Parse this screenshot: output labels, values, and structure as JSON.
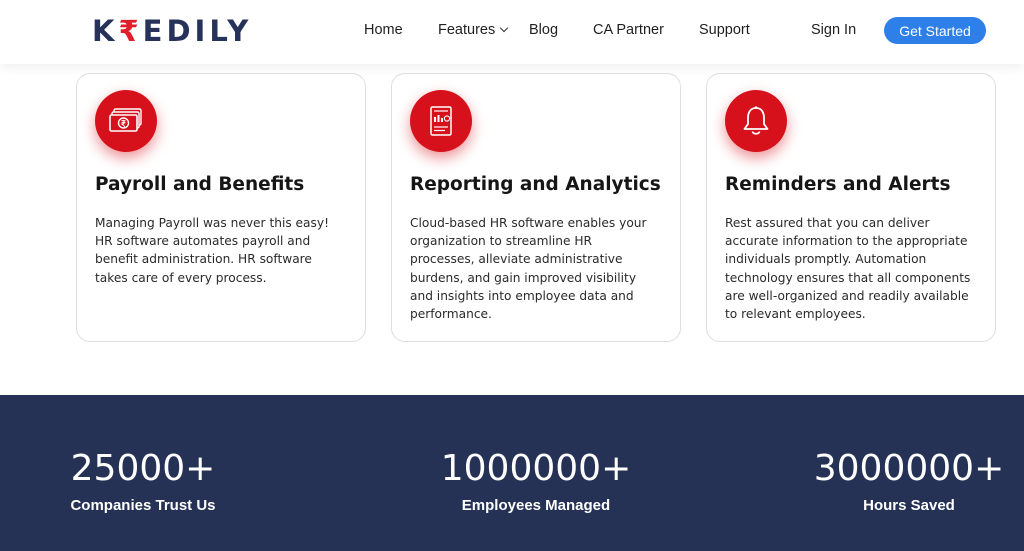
{
  "header": {
    "logo": {
      "prefix": "K",
      "mark": "₹",
      "suffix": "EDILY"
    },
    "nav": [
      "Home",
      "Features",
      "Blog",
      "CA Partner",
      "Support"
    ],
    "sign_in": "Sign In",
    "cta": "Get Started"
  },
  "cards": [
    {
      "icon": "money-icon",
      "title": "Payroll and Benefits",
      "description": "Managing Payroll was never this easy! HR software automates payroll and benefit administration. HR software takes care of every process."
    },
    {
      "icon": "report-chart-icon",
      "title": "Reporting and Analytics",
      "description": "Cloud-based HR software enables your organization to streamline HR processes, alleviate administrative burdens, and gain improved visibility and insights into employee data and performance."
    },
    {
      "icon": "bell-icon",
      "title": "Reminders and Alerts",
      "description": "Rest assured that you can deliver accurate information to the appropriate individuals promptly. Automation technology ensures that all components are well-organized and readily available to relevant employees."
    }
  ],
  "stats": [
    {
      "value": "25000+",
      "label": "Companies Trust Us"
    },
    {
      "value": "1000000+",
      "label": "Employees Managed"
    },
    {
      "value": "3000000+",
      "label": "Hours Saved"
    }
  ],
  "colors": {
    "brand_red": "#d7111c",
    "navy": "#263255",
    "accent_blue": "#2f7fe8"
  }
}
